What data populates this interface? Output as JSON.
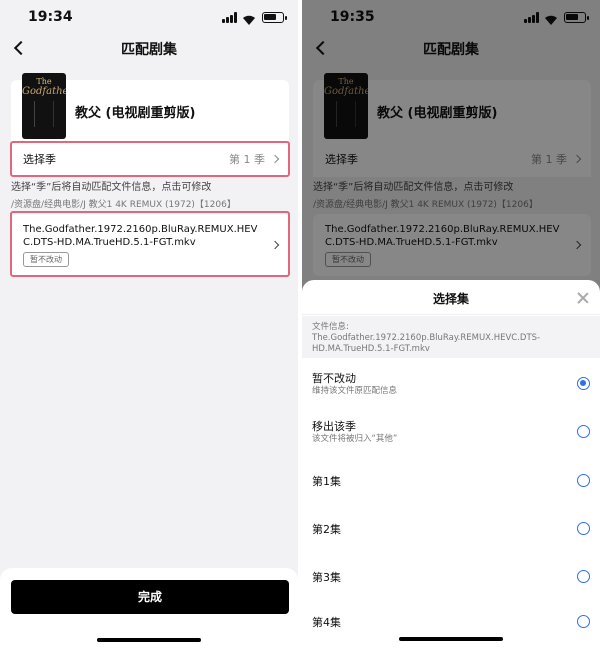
{
  "left": {
    "status": {
      "time": "19:34"
    },
    "nav": {
      "title": "匹配剧集"
    },
    "movie": {
      "title": "教父 (电视剧重剪版)",
      "poster_text_top": "The",
      "poster_text_main": "Godfather"
    },
    "season_row": {
      "label": "选择季",
      "value": "第 1 季"
    },
    "hint": "选择“季”后将自动匹配文件信息，点击可修改",
    "path": "/资源盘/经典电影/J 教父1 4K REMUX (1972)【1206】",
    "file": {
      "name": "The.Godfather.1972.2160p.BluRay.REMUX.HEVC.DTS-HD.MA.TrueHD.5.1-FGT.mkv",
      "badge": "暂不改动"
    },
    "done_button": "完成"
  },
  "right": {
    "status": {
      "time": "19:35"
    },
    "sheet": {
      "title": "选择集",
      "file_info_label": "文件信息:",
      "file_info_value": "The.Godfather.1972.2160p.BluRay.REMUX.HEVC.DTS-HD.MA.TrueHD.5.1-FGT.mkv",
      "options": [
        {
          "title": "暂不改动",
          "subtitle": "维持该文件原匹配信息",
          "selected": true
        },
        {
          "title": "移出该季",
          "subtitle": "该文件将被归入“其他”",
          "selected": false
        },
        {
          "title": "第1集",
          "subtitle": "",
          "selected": false
        },
        {
          "title": "第2集",
          "subtitle": "",
          "selected": false
        },
        {
          "title": "第3集",
          "subtitle": "",
          "selected": false
        },
        {
          "title": "第4集",
          "subtitle": "",
          "selected": false
        }
      ]
    }
  },
  "colors": {
    "highlight": "#e0677e",
    "accent": "#2f6df2",
    "button": "#000000"
  }
}
